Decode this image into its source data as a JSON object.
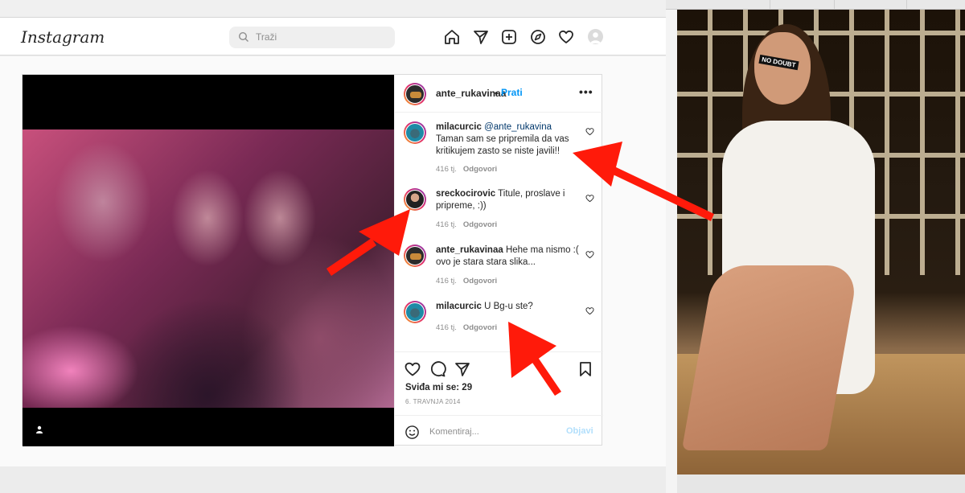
{
  "header": {
    "logo": "Instagram",
    "search_placeholder": "Traži",
    "nav_icons": [
      "home-icon",
      "direct-icon",
      "new-post-icon",
      "explore-icon",
      "activity-icon",
      "profile-icon"
    ]
  },
  "post": {
    "owner": "ante_rukavinaa",
    "separator": "•",
    "follow_label": "Prati",
    "more_label": "•••",
    "comments": [
      {
        "user": "milacurcic",
        "mention": "@ante_rukavina",
        "text": "Taman sam se pripremila da vas kritikujem zasto se niste javili!!",
        "time": "416 tj.",
        "reply": "Odgovori"
      },
      {
        "user": "sreckocirovic",
        "mention": "",
        "text": "Titule, proslave i pripreme, :))",
        "time": "416 tj.",
        "reply": "Odgovori"
      },
      {
        "user": "ante_rukavinaa",
        "mention": "",
        "text": "Hehe ma nismo :( ovo je stara stara slika...",
        "time": "416 tj.",
        "reply": "Odgovori"
      },
      {
        "user": "milacurcic",
        "mention": "",
        "text": "U Bg-u ste?",
        "time": "416 tj.",
        "reply": "Odgovori"
      }
    ],
    "likes": "Sviđa mi se: 29",
    "date": "6. TRAVNJA 2014",
    "comment_placeholder": "Komentiraj...",
    "post_label": "Objavi"
  },
  "side_photo": {
    "hairclip_text": "NO DOUBT"
  },
  "colors": {
    "accent": "#0095f6",
    "arrow": "#ff1a0a",
    "text": "#262626",
    "muted": "#8e8e8e"
  }
}
